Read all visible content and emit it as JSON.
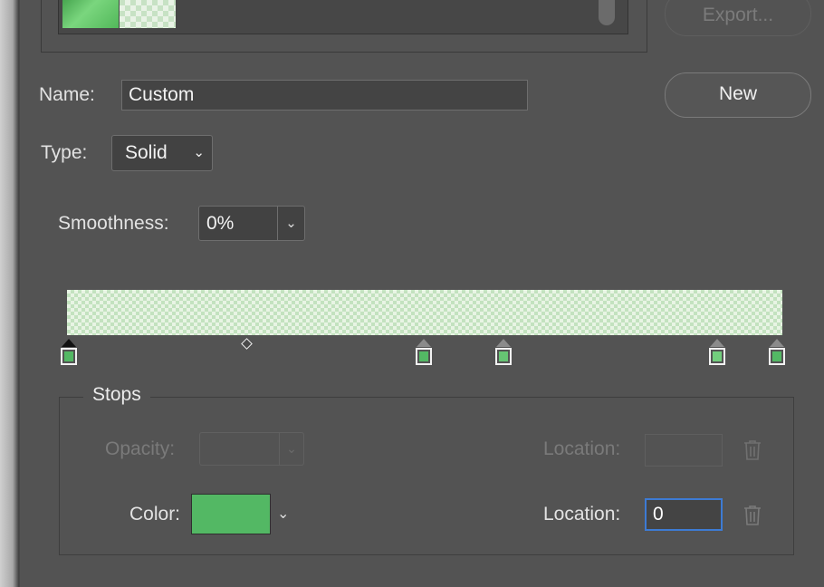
{
  "presets": {
    "swatches": [
      {
        "name": "green-gradient",
        "color": "#52b85a"
      },
      {
        "name": "transparent-green-checker",
        "color": "#e9f3e6"
      }
    ],
    "export_label": "Export..."
  },
  "new_button_label": "New",
  "name": {
    "label": "Name:",
    "value": "Custom"
  },
  "type": {
    "label": "Type:",
    "value": "Solid"
  },
  "smoothness": {
    "label": "Smoothness:",
    "value": "0%"
  },
  "gradient": {
    "color_stops": [
      {
        "location": 0,
        "color": "#53b864",
        "selected": true
      },
      {
        "location": 50,
        "color": "#53b864"
      },
      {
        "location": 61,
        "color": "#66c473"
      },
      {
        "location": 91,
        "color": "#72ce7d"
      },
      {
        "location": 100,
        "color": "#53b864"
      }
    ],
    "midpoint_location": 25
  },
  "stops": {
    "legend": "Stops",
    "opacity_label": "Opacity:",
    "opacity_value": "",
    "opacity_location_label": "Location:",
    "opacity_location_value": "",
    "color_label": "Color:",
    "color_value": "#53b864",
    "color_location_label": "Location:",
    "color_location_value": "0"
  }
}
